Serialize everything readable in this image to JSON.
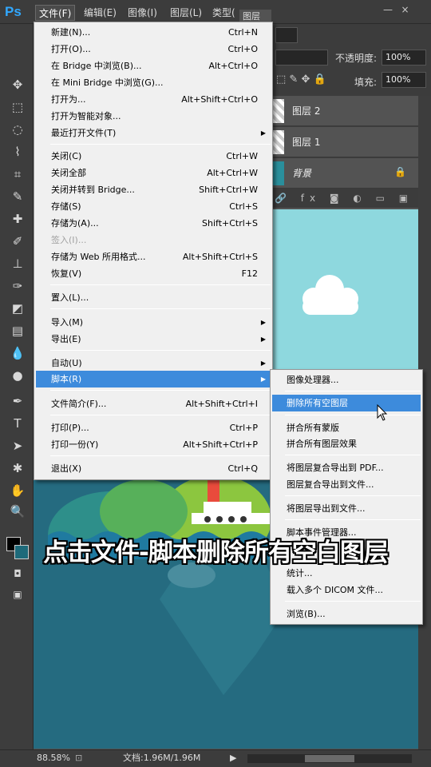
{
  "app": {
    "logo": "Ps"
  },
  "menubar": {
    "items": [
      "文件(F)",
      "编辑(E)",
      "图像(I)",
      "图层(L)",
      "类型("
    ],
    "active": "文件(F)"
  },
  "window_buttons": [
    "—",
    "×"
  ],
  "panel": {
    "tab_label": "图层",
    "opacity_label": "不透明度:",
    "opacity_value": "100%",
    "fill_label": "填充:",
    "fill_value": "100%",
    "layers": [
      {
        "name": "图层 2"
      },
      {
        "name": "图层 1"
      },
      {
        "name": "背景",
        "locked": true
      }
    ],
    "footer_icons": [
      "link-icon",
      "fx-icon",
      "mask-icon",
      "adjustment-icon",
      "folder-icon",
      "new-layer-icon",
      "trash-icon"
    ]
  },
  "file_menu": {
    "items": [
      {
        "label": "新建(N)...",
        "shortcut": "Ctrl+N"
      },
      {
        "label": "打开(O)...",
        "shortcut": "Ctrl+O"
      },
      {
        "label": "在 Bridge 中浏览(B)...",
        "shortcut": "Alt+Ctrl+O"
      },
      {
        "label": "在 Mini Bridge 中浏览(G)...",
        "shortcut": ""
      },
      {
        "label": "打开为...",
        "shortcut": "Alt+Shift+Ctrl+O"
      },
      {
        "label": "打开为智能对象...",
        "shortcut": ""
      },
      {
        "label": "最近打开文件(T)",
        "shortcut": "",
        "submenu": true
      },
      {
        "label": "关闭(C)",
        "shortcut": "Ctrl+W"
      },
      {
        "label": "关闭全部",
        "shortcut": "Alt+Ctrl+W"
      },
      {
        "label": "关闭并转到 Bridge...",
        "shortcut": "Shift+Ctrl+W"
      },
      {
        "label": "存储(S)",
        "shortcut": "Ctrl+S"
      },
      {
        "label": "存储为(A)...",
        "shortcut": "Shift+Ctrl+S"
      },
      {
        "label": "签入(I)...",
        "shortcut": "",
        "disabled": true
      },
      {
        "label": "存储为 Web 所用格式...",
        "shortcut": "Alt+Shift+Ctrl+S"
      },
      {
        "label": "恢复(V)",
        "shortcut": "F12"
      },
      {
        "label": "置入(L)...",
        "shortcut": ""
      },
      {
        "label": "导入(M)",
        "shortcut": "",
        "submenu": true
      },
      {
        "label": "导出(E)",
        "shortcut": "",
        "submenu": true
      },
      {
        "label": "自动(U)",
        "shortcut": "",
        "submenu": true
      },
      {
        "label": "脚本(R)",
        "shortcut": "",
        "submenu": true,
        "highlighted": true
      },
      {
        "label": "文件简介(F)...",
        "shortcut": "Alt+Shift+Ctrl+I"
      },
      {
        "label": "打印(P)...",
        "shortcut": "Ctrl+P"
      },
      {
        "label": "打印一份(Y)",
        "shortcut": "Alt+Shift+Ctrl+P"
      },
      {
        "label": "退出(X)",
        "shortcut": "Ctrl+Q"
      }
    ]
  },
  "script_submenu": {
    "items": [
      {
        "label": "图像处理器..."
      },
      {
        "label": "删除所有空图层",
        "highlighted": true
      },
      {
        "label": "拼合所有蒙版"
      },
      {
        "label": "拼合所有图层效果"
      },
      {
        "label": "将图层复合导出到 PDF..."
      },
      {
        "label": "图层复合导出到文件..."
      },
      {
        "label": "将图层导出到文件..."
      },
      {
        "label": "脚本事件管理器..."
      },
      {
        "label": "统计..."
      },
      {
        "label": "载入多个 DICOM 文件..."
      },
      {
        "label": "浏览(B)..."
      }
    ]
  },
  "status": {
    "zoom": "88.58%",
    "doc": "文档:1.96M/1.96M"
  },
  "caption": "点击文件-脚本删除所有空白图层",
  "colors": {
    "foreground": "#000000",
    "background": "#1e6a7a",
    "accent": "#3d8bdc",
    "sky": "#8ed8de",
    "sea": "#256b80"
  }
}
